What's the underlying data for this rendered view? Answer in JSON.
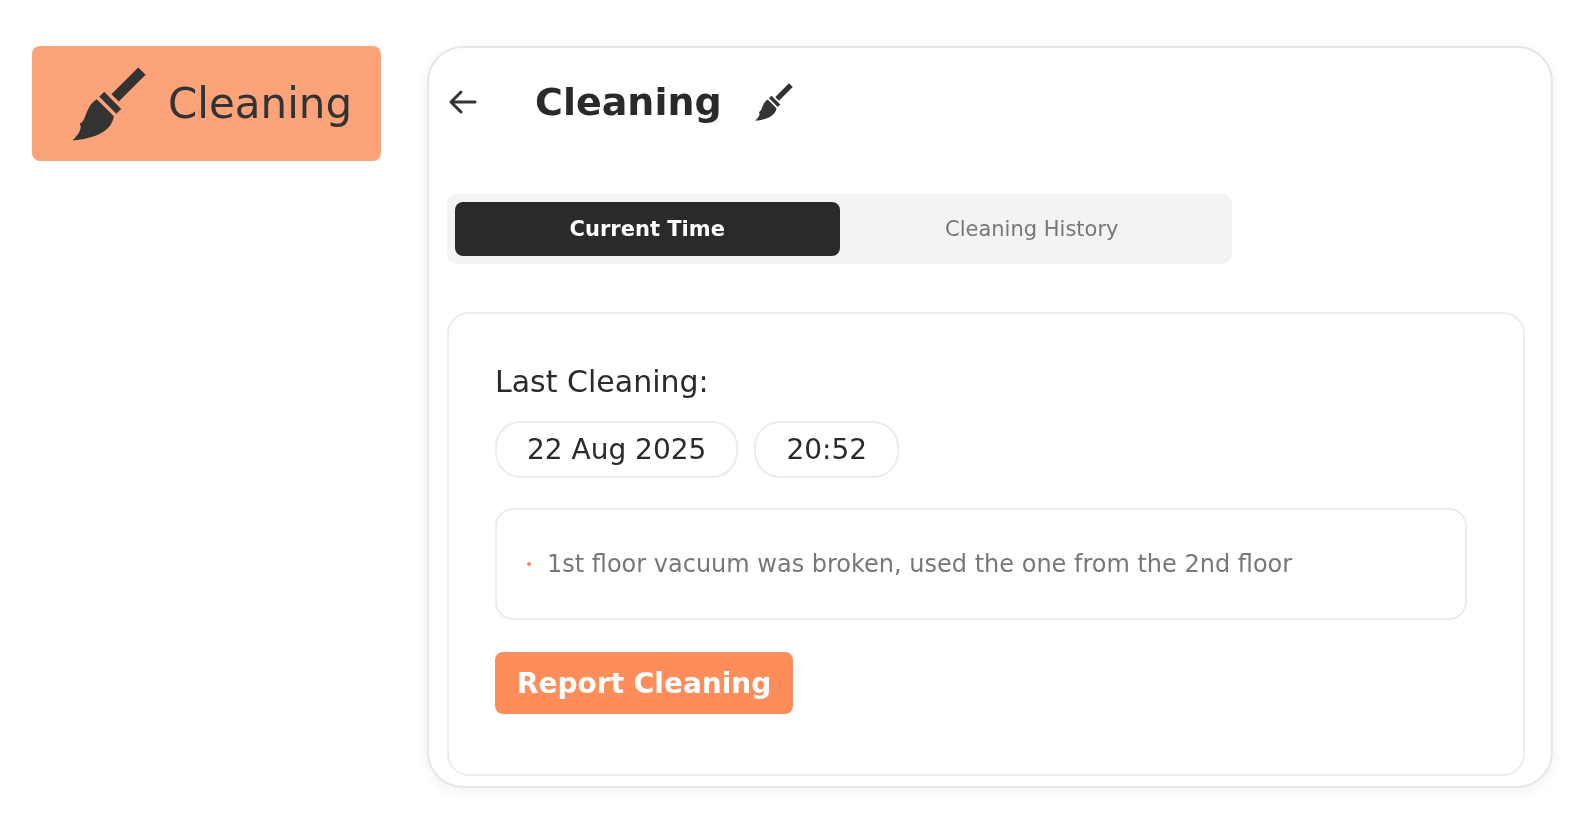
{
  "badge": {
    "label": "Cleaning"
  },
  "panel": {
    "title": "Cleaning"
  },
  "tabs": [
    {
      "label": "Current Time",
      "selected": true
    },
    {
      "label": "Cleaning History",
      "selected": false
    }
  ],
  "card": {
    "heading": "Last Cleaning:",
    "date": "22 Aug 2025",
    "time": "20:52",
    "notes": [
      "1st floor vacuum was broken, used the one from the 2nd floor"
    ],
    "button": "Report Cleaning"
  }
}
